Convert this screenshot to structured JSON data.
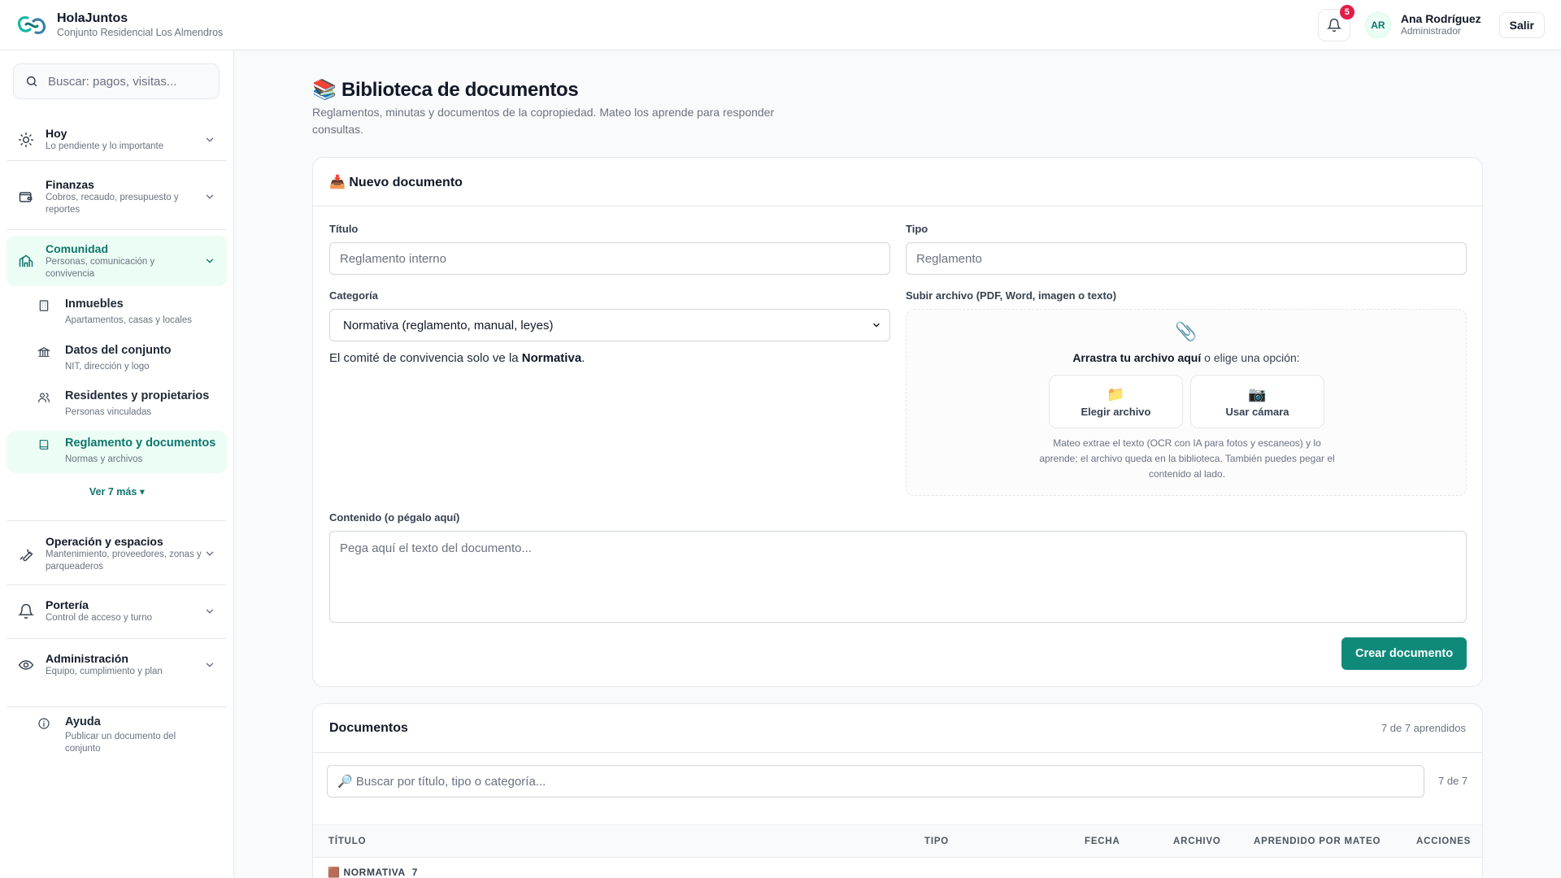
{
  "app": {
    "name": "HolaJuntos",
    "community": "Conjunto Residencial Los Almendros"
  },
  "header": {
    "notifications_count": "5",
    "user_initials": "AR",
    "user_name": "Ana Rodríguez",
    "user_role": "Administrador",
    "logout_label": "Salir"
  },
  "sidebar": {
    "search_placeholder": "Buscar: pagos, visitas...",
    "groups": [
      {
        "title": "Hoy",
        "subtitle": "Lo pendiente y lo importante",
        "icon": "sun-icon"
      },
      {
        "title": "Finanzas",
        "subtitle": "Cobros, recaudo, presupuesto y reportes",
        "icon": "wallet-icon"
      },
      {
        "title": "Comunidad",
        "subtitle": "Personas, comunicación y convivencia",
        "icon": "community-icon",
        "expanded": true
      },
      {
        "title": "Operación y espacios",
        "subtitle": "Mantenimiento, proveedores, zonas y parqueaderos",
        "icon": "wrench-icon"
      },
      {
        "title": "Portería",
        "subtitle": "Control de acceso y turno",
        "icon": "bell-icon"
      },
      {
        "title": "Administración",
        "subtitle": "Equipo, cumplimiento y plan",
        "icon": "eye-settings-icon"
      }
    ],
    "community_items": [
      {
        "title": "Inmuebles",
        "subtitle": "Apartamentos, casas y locales",
        "icon": "building-icon"
      },
      {
        "title": "Datos del conjunto",
        "subtitle": "NIT, dirección y logo",
        "icon": "bank-icon"
      },
      {
        "title": "Residentes y propietarios",
        "subtitle": "Personas vinculadas",
        "icon": "users-icon"
      },
      {
        "title": "Reglamento y documentos",
        "subtitle": "Normas y archivos",
        "icon": "book-icon",
        "active": true
      }
    ],
    "more_label": "Ver 7 más ▾",
    "help": {
      "title": "Ayuda",
      "subtitle": "Publicar un documento del conjunto"
    }
  },
  "page": {
    "title": "📚 Biblioteca de documentos",
    "description": "Reglamentos, minutas y documentos de la copropiedad. Mateo los aprende para responder consultas."
  },
  "new_document": {
    "heading": "📥 Nuevo documento",
    "title_label": "Título",
    "title_placeholder": "Reglamento interno",
    "type_label": "Tipo",
    "type_placeholder": "Reglamento",
    "category_label": "Categoría",
    "category_value": "Normativa (reglamento, manual, leyes)",
    "committee_note_prefix": "El comité de convivencia solo ve la ",
    "committee_note_bold": "Normativa",
    "committee_note_suffix": ".",
    "upload_label": "Subir archivo (PDF, Word, imagen o texto)",
    "drop_bold": "Arrastra tu archivo aquí",
    "drop_rest": " o elige una opción:",
    "choose_file_label": "Elegir archivo",
    "use_camera_label": "Usar cámara",
    "upload_help": "Mateo extrae el texto (OCR con IA para fotos y escaneos) y lo aprende; el archivo queda en la biblioteca. También puedes pegar el contenido al lado.",
    "content_label": "Contenido (o pégalo aquí)",
    "content_placeholder": "Pega aquí el texto del documento...",
    "create_label": "Crear documento"
  },
  "documents": {
    "heading": "Documentos",
    "learned_count": "7 de 7 aprendidos",
    "search_placeholder": "🔎 Buscar por título, tipo o categoría...",
    "search_count": "7 de 7",
    "columns": [
      "TÍTULO",
      "TIPO",
      "FECHA",
      "ARCHIVO",
      "APRENDIDO POR MATEO",
      "ACCIONES"
    ],
    "group_label": "🟫 NORMATIVA",
    "group_count": "7"
  },
  "colors": {
    "accent": "#0f8a7a",
    "accent_text": "#0f766e",
    "active_bg": "#ecfdf5",
    "badge": "#e11d48"
  }
}
